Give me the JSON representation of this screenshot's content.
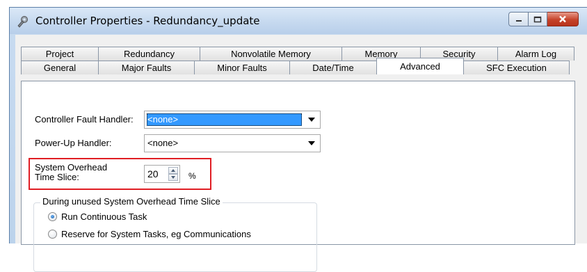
{
  "window": {
    "title": "Controller Properties - Redundancy_update",
    "icon": "wrench-icon",
    "controls": {
      "minimize": "minimize-icon",
      "maximize": "maximize-icon",
      "close": "close-icon"
    }
  },
  "tabs": {
    "row_back": [
      "Project",
      "Redundancy",
      "Nonvolatile Memory",
      "Memory",
      "Security",
      "Alarm Log"
    ],
    "row_front": [
      "General",
      "Major Faults",
      "Minor Faults",
      "Date/Time",
      "Advanced",
      "SFC Execution"
    ],
    "active": "Advanced"
  },
  "form": {
    "fault_handler": {
      "label": "Controller Fault Handler:",
      "value": "<none>"
    },
    "powerup_handler": {
      "label": "Power-Up Handler:",
      "value": "<none>"
    },
    "overhead": {
      "label_line1": "System Overhead",
      "label_line2": "Time Slice:",
      "value": "20",
      "unit": "%"
    },
    "unused_group": {
      "title": "During unused System Overhead Time Slice",
      "options": [
        {
          "label": "Run Continuous Task",
          "checked": true
        },
        {
          "label": "Reserve for System Tasks, eg Communications",
          "checked": false
        }
      ]
    }
  },
  "colors": {
    "highlight": "#e01e24",
    "selection": "#3399ff"
  }
}
